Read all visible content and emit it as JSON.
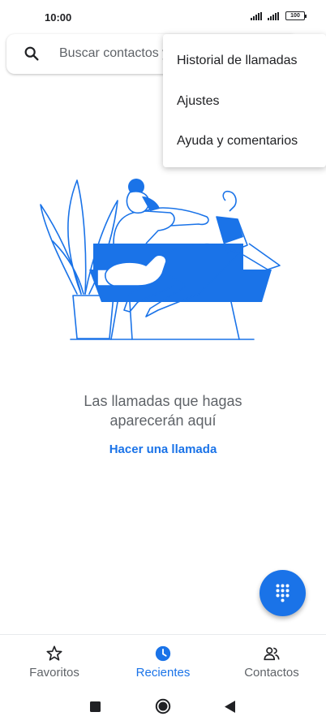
{
  "status_bar": {
    "time": "10:00",
    "battery": "100"
  },
  "search": {
    "placeholder": "Buscar contactos y lugares"
  },
  "menu": {
    "items": [
      "Historial de llamadas",
      "Ajustes",
      "Ayuda y comentarios"
    ]
  },
  "empty_state": {
    "line1": "Las llamadas que hagas",
    "line2": "aparecerán aquí",
    "action": "Hacer una llamada"
  },
  "bottom_nav": {
    "items": [
      {
        "label": "Favoritos",
        "icon": "star-icon",
        "active": false
      },
      {
        "label": "Recientes",
        "icon": "clock-icon",
        "active": true
      },
      {
        "label": "Contactos",
        "icon": "people-icon",
        "active": false
      }
    ]
  },
  "colors": {
    "accent": "#1a73e8",
    "text": "#202124",
    "secondary": "#5f6368"
  },
  "system_nav": {
    "icons": [
      "recents-square-icon",
      "home-circle-icon",
      "back-triangle-icon"
    ]
  }
}
